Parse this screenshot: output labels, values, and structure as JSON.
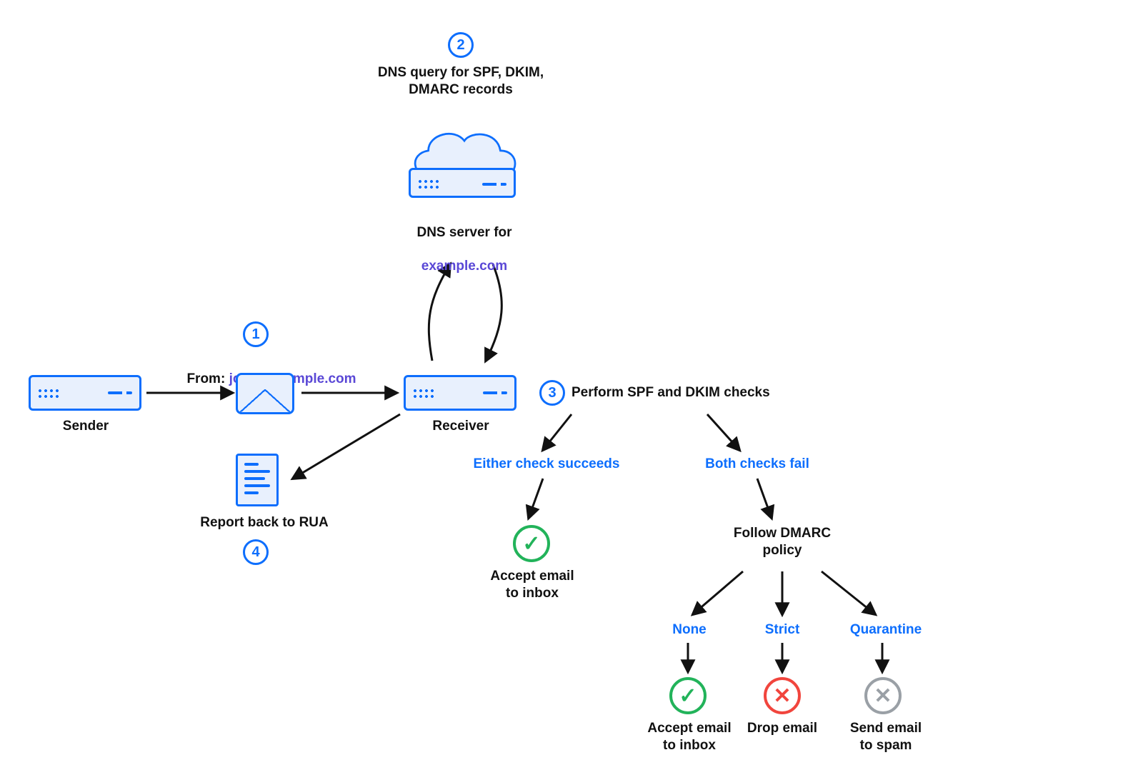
{
  "steps": {
    "s1": "1",
    "s2": "2",
    "s3": "3",
    "s4": "4"
  },
  "captions": {
    "step2": "DNS query for SPF, DKIM,\nDMARC records",
    "dns_server_prefix": "DNS server for",
    "dns_server_domain": "example.com",
    "from_prefix": "From: ",
    "from_email": "joao@example.com",
    "sender": "Sender",
    "receiver": "Receiver",
    "report_rua": "Report back to RUA",
    "step3": "Perform SPF and DKIM checks",
    "either_succeeds": "Either check succeeds",
    "both_fail": "Both checks fail",
    "accept_inbox": "Accept email\nto inbox",
    "follow_policy": "Follow DMARC\npolicy",
    "none": "None",
    "strict": "Strict",
    "quarantine": "Quarantine",
    "drop_email": "Drop email",
    "send_spam": "Send email\nto spam"
  },
  "colors": {
    "blue": "#0d6efd",
    "purple": "#5a48d6",
    "green": "#22b35a",
    "red": "#f1453d",
    "gray": "#9aa0a6"
  }
}
